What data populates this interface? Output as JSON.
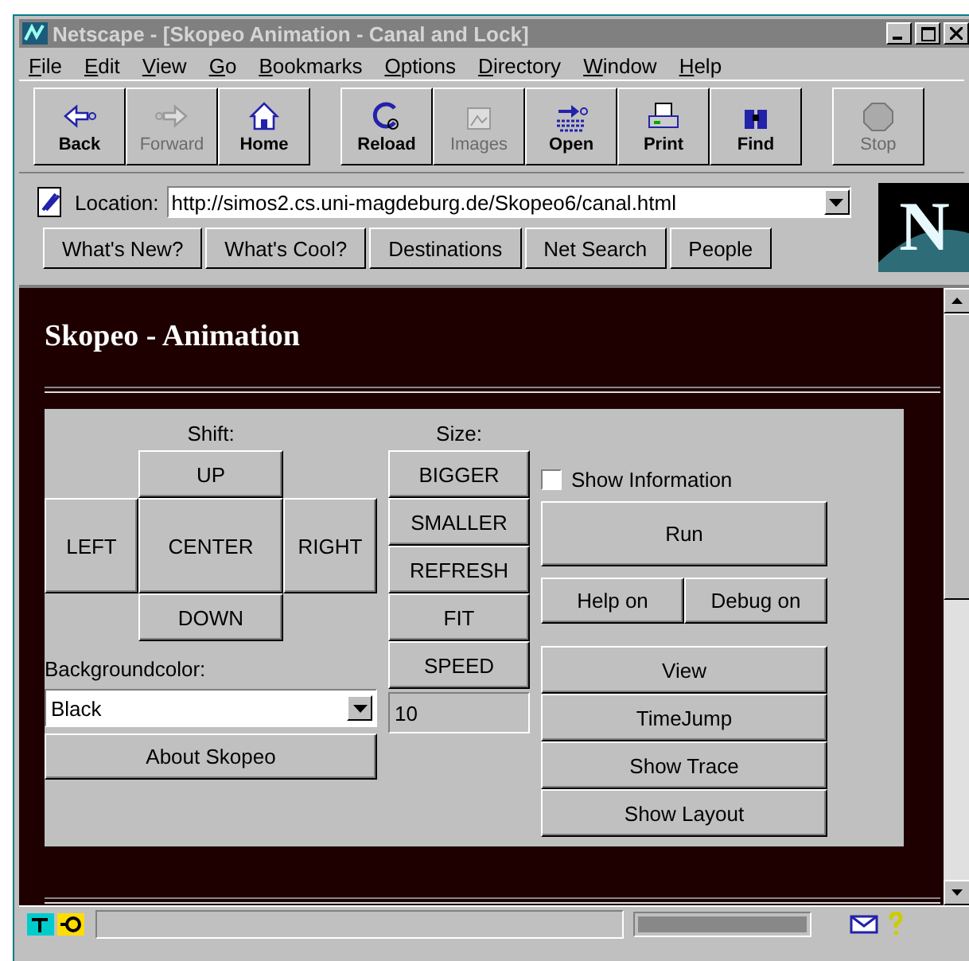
{
  "window": {
    "title": "Netscape - [Skopeo Animation - Canal and Lock]"
  },
  "menu": [
    "File",
    "Edit",
    "View",
    "Go",
    "Bookmarks",
    "Options",
    "Directory",
    "Window",
    "Help"
  ],
  "toolbar": [
    {
      "label": "Back",
      "disabled": false
    },
    {
      "label": "Forward",
      "disabled": true
    },
    {
      "label": "Home",
      "disabled": false
    },
    {
      "label": "Reload",
      "disabled": false
    },
    {
      "label": "Images",
      "disabled": true
    },
    {
      "label": "Open",
      "disabled": false
    },
    {
      "label": "Print",
      "disabled": false
    },
    {
      "label": "Find",
      "disabled": false
    },
    {
      "label": "Stop",
      "disabled": true
    }
  ],
  "location": {
    "label": "Location:",
    "url": "http://simos2.cs.uni-magdeburg.de/Skopeo6/canal.html"
  },
  "directory": [
    "What's New?",
    "What's Cool?",
    "Destinations",
    "Net Search",
    "People"
  ],
  "logo": "N",
  "progress": {
    "level": 1
  },
  "page": {
    "title": "Skopeo - Animation",
    "shift_label": "Shift:",
    "shift": {
      "up": "UP",
      "left": "LEFT",
      "center": "CENTER",
      "right": "RIGHT",
      "down": "DOWN"
    },
    "bg_label": "Backgroundcolor:",
    "bg_value": "Black",
    "about": "About Skopeo",
    "size_label": "Size:",
    "size": [
      "BIGGER",
      "SMALLER",
      "REFRESH",
      "FIT",
      "SPEED"
    ],
    "speed_value": "10",
    "show_info": {
      "label": "Show Information",
      "checked": false
    },
    "run": "Run",
    "help": "Help on",
    "debug": "Debug on",
    "actions": [
      "View",
      "TimeJump",
      "Show Trace",
      "Show Layout"
    ]
  }
}
